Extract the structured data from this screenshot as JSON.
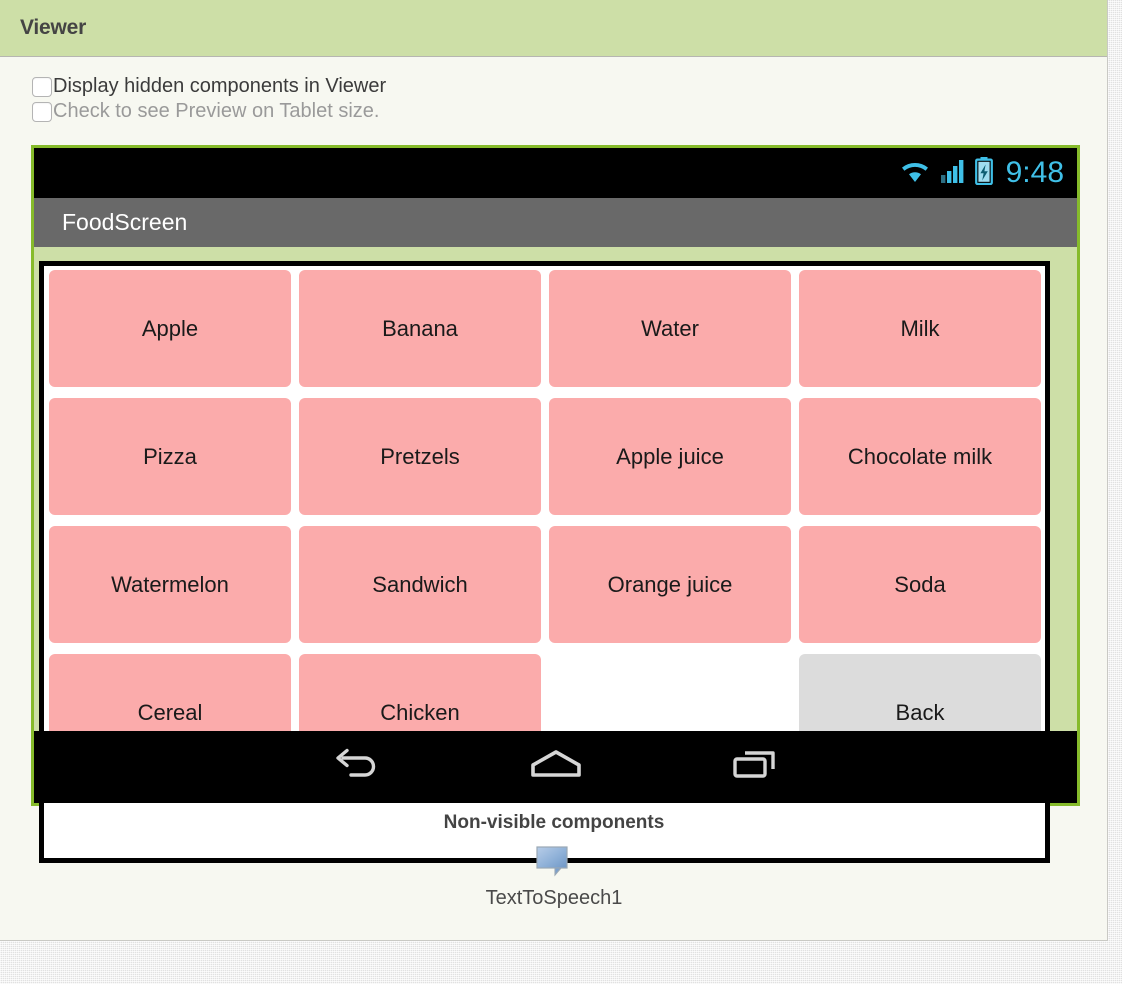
{
  "panel": {
    "header_title": "Viewer",
    "options": [
      {
        "label": "Display hidden components in Viewer",
        "checked": false,
        "disabled": false,
        "name": "display-hidden-components"
      },
      {
        "label": "Check to see Preview on Tablet size.",
        "checked": false,
        "disabled": true,
        "name": "preview-tablet-size"
      }
    ]
  },
  "phone": {
    "status_bar": {
      "time": "9:48",
      "icons": [
        "wifi-icon",
        "signal-icon",
        "battery-charging-icon"
      ],
      "background": "#000000",
      "text_color": "#40c0e8"
    },
    "title_bar": {
      "text": "FoodScreen",
      "background": "#696969",
      "text_color": "#ffffff"
    },
    "frame": {
      "border_color": "#86bb2b",
      "inner_color": "#cddfa7"
    },
    "buttons": [
      {
        "label": "Apple",
        "type": "food",
        "color": "#fbabab"
      },
      {
        "label": "Banana",
        "type": "food",
        "color": "#fbabab"
      },
      {
        "label": "Water",
        "type": "food",
        "color": "#fbabab"
      },
      {
        "label": "Milk",
        "type": "food",
        "color": "#fbabab"
      },
      {
        "label": "Pizza",
        "type": "food",
        "color": "#fbabab"
      },
      {
        "label": "Pretzels",
        "type": "food",
        "color": "#fbabab"
      },
      {
        "label": "Apple juice",
        "type": "food",
        "color": "#fbabab"
      },
      {
        "label": "Chocolate milk",
        "type": "food",
        "color": "#fbabab"
      },
      {
        "label": "Watermelon",
        "type": "food",
        "color": "#fbabab"
      },
      {
        "label": "Sandwich",
        "type": "food",
        "color": "#fbabab"
      },
      {
        "label": "Orange juice",
        "type": "food",
        "color": "#fbabab"
      },
      {
        "label": "Soda",
        "type": "food",
        "color": "#fbabab"
      },
      {
        "label": "Cereal",
        "type": "food",
        "color": "#fbabab"
      },
      {
        "label": "Chicken",
        "type": "food",
        "color": "#fbabab"
      },
      {
        "label": "",
        "type": "spacer",
        "color": "#ffffff"
      },
      {
        "label": "Back",
        "type": "back",
        "color": "#dcdcdc"
      }
    ],
    "nav_bar": {
      "icons": [
        "back-nav-icon",
        "home-nav-icon",
        "recents-nav-icon"
      ],
      "background": "#000000"
    }
  },
  "nonvisible": {
    "title": "Non-visible components",
    "components": [
      {
        "label": "TextToSpeech1",
        "icon": "speech-bubble-icon"
      }
    ]
  }
}
